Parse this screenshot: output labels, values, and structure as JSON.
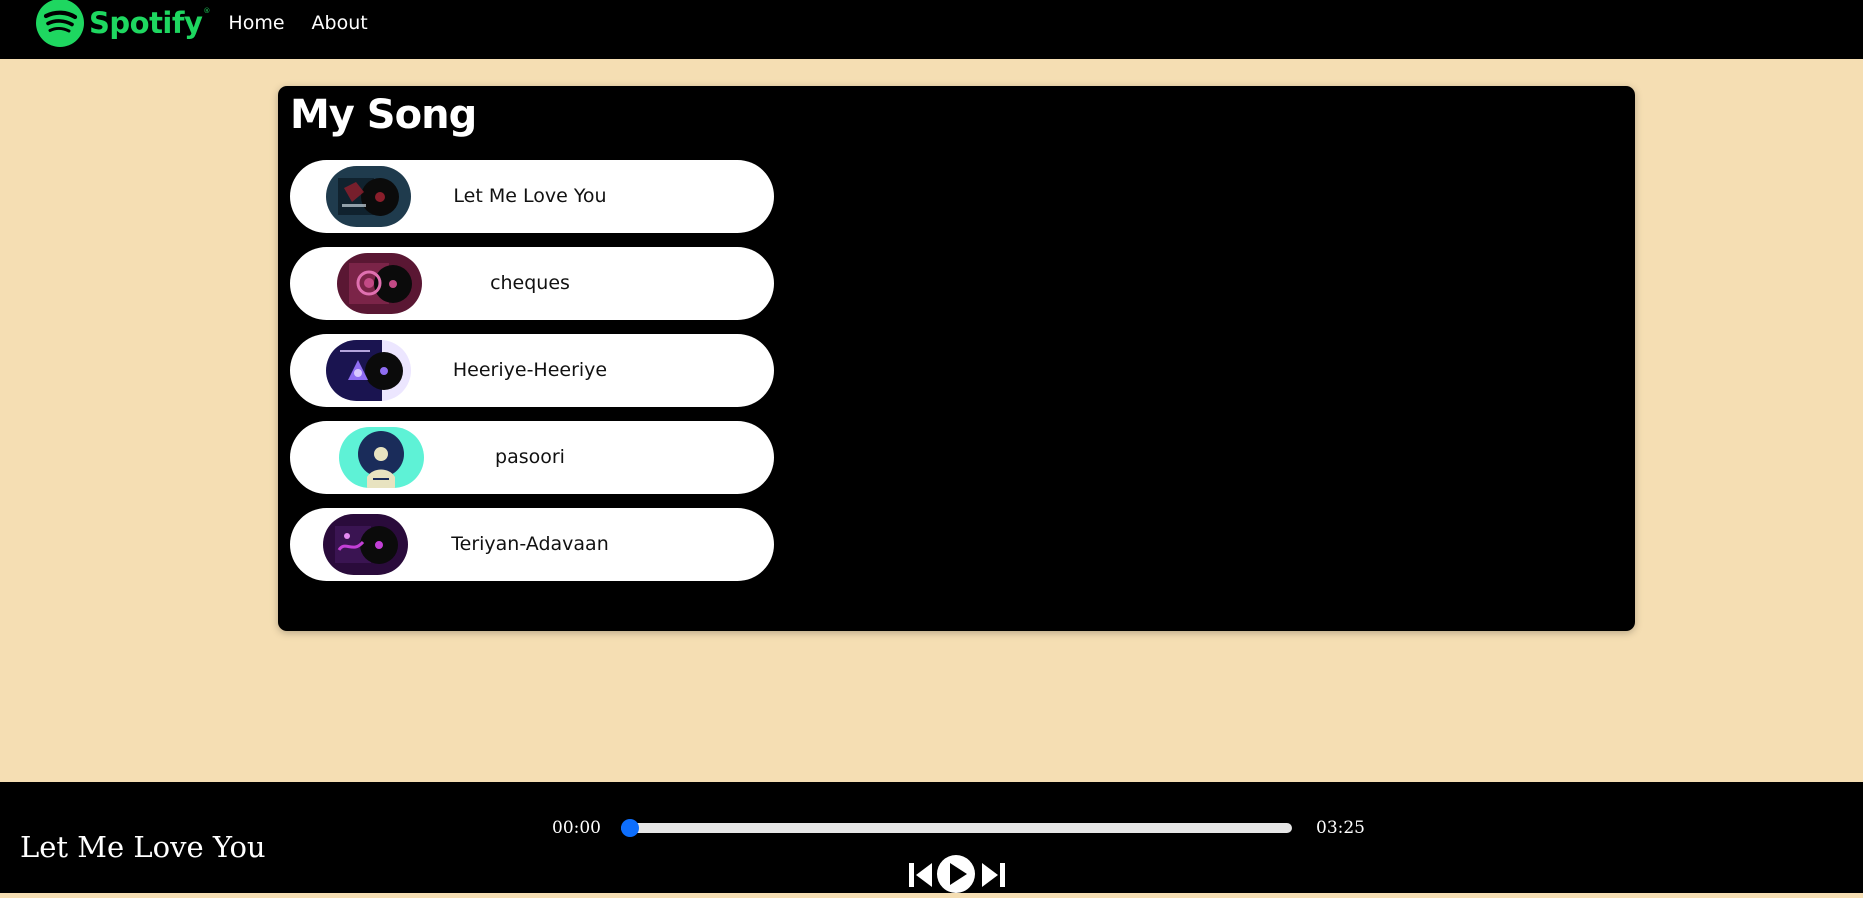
{
  "navbar": {
    "brand": "Spotify",
    "brand_mark": "®",
    "logo_icon": "spotify-logo-icon",
    "links": [
      {
        "label": "Home"
      },
      {
        "label": "About"
      }
    ]
  },
  "main": {
    "title": "My Song",
    "songs": [
      {
        "name": "Let Me Love You",
        "cover_colors": [
          "#1f3b4d",
          "#8a1e2b"
        ]
      },
      {
        "name": "cheques",
        "cover_colors": [
          "#5a1733",
          "#c34a86"
        ]
      },
      {
        "name": "Heeriye-Heeriye",
        "cover_colors": [
          "#1a1450",
          "#8f6df2"
        ]
      },
      {
        "name": "pasoori",
        "cover_colors": [
          "#5ef2d6",
          "#1a2c5a"
        ]
      },
      {
        "name": "Teriyan-Adavaan",
        "cover_colors": [
          "#2a0b3b",
          "#c23fd6"
        ]
      }
    ]
  },
  "player": {
    "now_playing": "Let Me Love You",
    "current_time": "00:00",
    "total_time": "03:25",
    "progress_percent": 0,
    "accent_color": "#0d6efd",
    "controls": [
      {
        "icon": "previous-icon"
      },
      {
        "icon": "play-icon"
      },
      {
        "icon": "next-icon"
      }
    ]
  },
  "colors": {
    "page_background": "#f5deb3",
    "brand_green": "#1ed760",
    "panel_background": "#000000"
  }
}
